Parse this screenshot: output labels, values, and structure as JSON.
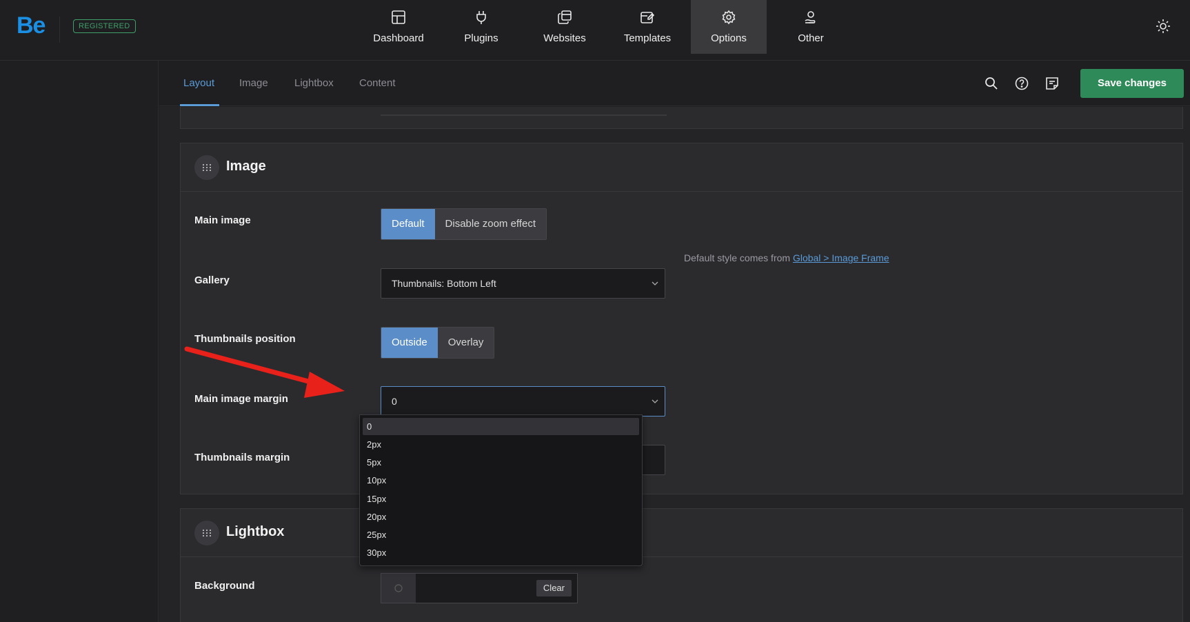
{
  "brand": {
    "logo": "Be",
    "badge": "REGISTERED"
  },
  "nav": [
    {
      "label": "Dashboard",
      "icon": "dashboard-icon"
    },
    {
      "label": "Plugins",
      "icon": "plug-icon"
    },
    {
      "label": "Websites",
      "icon": "websites-icon"
    },
    {
      "label": "Templates",
      "icon": "templates-icon"
    },
    {
      "label": "Options",
      "icon": "gear-icon",
      "active": true
    },
    {
      "label": "Other",
      "icon": "user-hand-icon"
    }
  ],
  "subtabs": [
    {
      "label": "Layout",
      "active": true
    },
    {
      "label": "Image"
    },
    {
      "label": "Lightbox"
    },
    {
      "label": "Content"
    }
  ],
  "toolbar": {
    "save_label": "Save changes"
  },
  "image_panel": {
    "title": "Image",
    "main_image": {
      "label": "Main image",
      "options": [
        "Default",
        "Disable zoom effect"
      ],
      "selected": "Default"
    },
    "hint": {
      "text": "Default style comes from ",
      "link": "Global > Image Frame"
    },
    "gallery": {
      "label": "Gallery",
      "value": "Thumbnails: Bottom Left"
    },
    "thumbnails_position": {
      "label": "Thumbnails position",
      "options": [
        "Outside",
        "Overlay"
      ],
      "selected": "Outside"
    },
    "main_image_margin": {
      "label": "Main image margin",
      "value": "0"
    },
    "thumbnails_margin": {
      "label": "Thumbnails margin"
    }
  },
  "margin_dropdown": {
    "options": [
      "0",
      "2px",
      "5px",
      "10px",
      "15px",
      "20px",
      "25px",
      "30px"
    ],
    "selected": "0"
  },
  "lightbox_panel": {
    "title": "Lightbox",
    "background": {
      "label": "Background",
      "clear_label": "Clear"
    }
  },
  "colors": {
    "accent": "#5b8ec9",
    "save": "#2e8a58",
    "badge": "#3fa06a",
    "annotation_arrow": "#e8211a"
  }
}
